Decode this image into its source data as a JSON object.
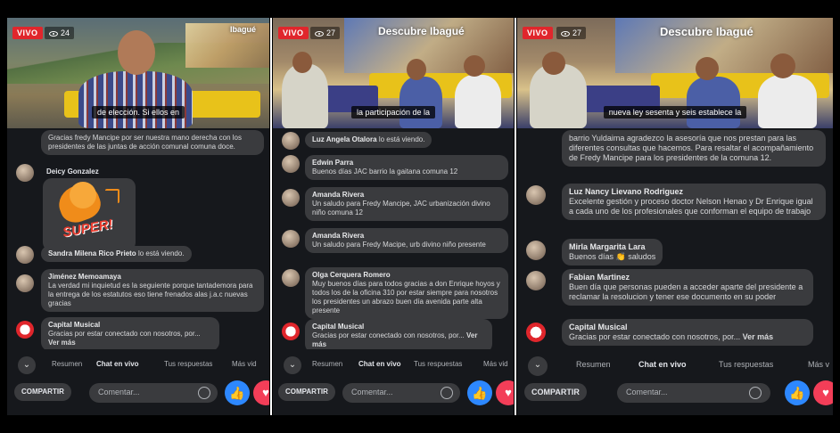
{
  "panels": [
    {
      "live_label": "VIVO",
      "viewers": "24",
      "brand": "Ibagué",
      "caption": "de elección. Si ellos en",
      "comments": [
        {
          "name": "",
          "text": "Gracias fredy Mancipe por ser nuestra mano derecha con los presidentes de las juntas de acción comunal comuna doce."
        },
        {
          "name": "Deicy Gonzalez",
          "sticker": "SUPER!"
        },
        {
          "name": "Sandra Milena Rico Prieto",
          "text": "lo está viendo."
        },
        {
          "name": "Jiménez Memoamaya",
          "text": "La verdad mi inquietud es la seguiente porque tantademora para la entrega de los estatutos eso tiene frenados alas j.a.c nuevas gracias"
        },
        {
          "name": "Capital Musical",
          "text": "Gracias por estar conectado con nosotros, por...",
          "more": "Ver más"
        }
      ],
      "tabs": [
        "Resumen",
        "Chat en vivo",
        "Tus respuestas",
        "Más vid"
      ],
      "share": "COMPARTIR",
      "comment_placeholder": "Comentar..."
    },
    {
      "live_label": "VIVO",
      "viewers": "27",
      "brand": "Descubre Ibagué",
      "caption": "la participación de la",
      "comments": [
        {
          "name": "Luz Angela Otalora",
          "text": "lo está viendo."
        },
        {
          "name": "Edwin Parra",
          "text": "Buenos días JAC barrio la gaitana comuna 12"
        },
        {
          "name": "Amanda Rivera",
          "text": "Un saludo para Fredy Mancipe, JAC urbanización divino niño comuna 12"
        },
        {
          "name": "Amanda Rivera",
          "text": "Un saludo para Fredy Macipe, urb divino niño presente"
        },
        {
          "name": "Olga Cerquera Romero",
          "text": "Muy buenos días para todos gracias a don Enrique hoyos y todos los de la oficina 310 por estar siempre para nosotros los presidentes un abrazo buen día avenida parte alta presente"
        },
        {
          "name": "Capital Musical",
          "text": "Gracias por estar conectado con nosotros, por...",
          "more": "Ver más"
        }
      ],
      "tabs": [
        "Resumen",
        "Chat en vivo",
        "Tus respuestas",
        "Más vid"
      ],
      "share": "COMPARTIR",
      "comment_placeholder": "Comentar..."
    },
    {
      "live_label": "VIVO",
      "viewers": "27",
      "brand": "Descubre Ibagué",
      "caption": "nueva ley sesenta y seis establece la",
      "comments": [
        {
          "name": "",
          "text": "barrio Yuldaima agradezco la asesoría que nos prestan para las diferentes consultas que hacemos. Para resaltar el acompañamiento de Fredy Mancipe para los presidentes de la comuna 12."
        },
        {
          "name": "Luz Nancy Lievano Rodriguez",
          "text": "Excelente gestión y proceso doctor Nelson Henao y Dr Enrique igual a cada uno de los profesionales que conforman el equipo de trabajo"
        },
        {
          "name": "Mirla Margarita Lara",
          "text": "Buenos días 👏 saludos"
        },
        {
          "name": "Fabian Martinez",
          "text": "Buen día que personas pueden a acceder aparte del presidente a reclamar la resolucion y tener ese documento en su poder"
        },
        {
          "name": "Capital Musical",
          "text": "Gracias por estar conectado con nosotros, por...",
          "more": "Ver más"
        }
      ],
      "tabs": [
        "Resumen",
        "Chat en vivo",
        "Tus respuestas",
        "Más v"
      ],
      "share": "COMPARTIR",
      "comment_placeholder": "Comentar..."
    }
  ],
  "colors": {
    "live": "#e0262c",
    "like": "#2d88ff",
    "love": "#f33e58",
    "bubble": "#3a3b3e",
    "background": "#16181c"
  }
}
